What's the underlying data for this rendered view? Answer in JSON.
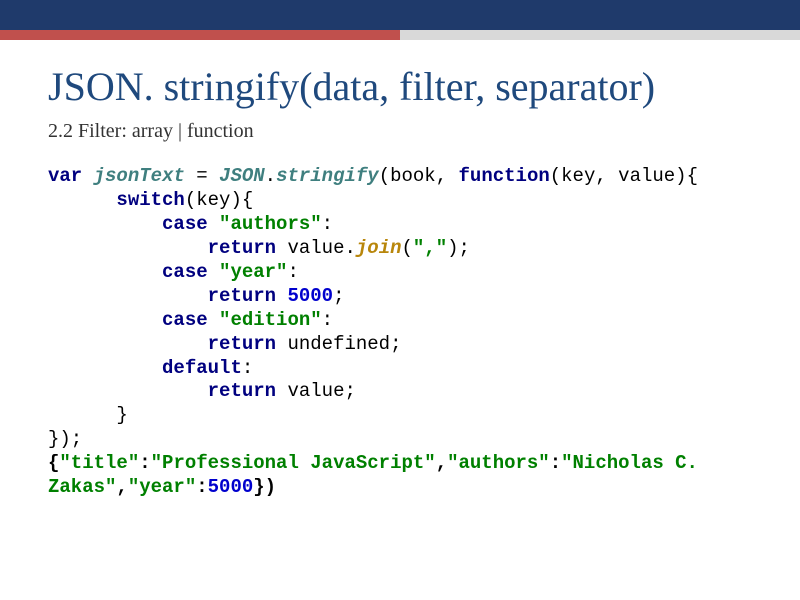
{
  "header": {
    "title": "JSON. stringify(data, filter, separator)",
    "subtitle": "2.2 Filter: array | function"
  },
  "code": {
    "t_var": "var",
    "t_jsonText": "jsonText",
    "t_eq": " = ",
    "t_JSON": "JSON",
    "t_dot": ".",
    "t_stringify": "stringify",
    "t_open1": "(book, ",
    "t_function": "function",
    "t_args": "(key, value){",
    "t_switch": "switch",
    "t_switchArg": "(key){",
    "t_case": "case",
    "t_authors": "\"authors\"",
    "t_colon": ":",
    "t_return": "return",
    "t_valDot": " value.",
    "t_join": "join",
    "t_joinOpen": "(",
    "t_comma": "\",\"",
    "t_joinClose": ");",
    "t_year": "\"year\"",
    "t_5000": "5000",
    "t_semi": ";",
    "t_edition": "\"edition\"",
    "t_undef": " undefined;",
    "t_default": "default",
    "t_retVal": " value;",
    "t_braceClose1": "      }",
    "t_braceClose2": "});",
    "t_resOpen": "{",
    "t_title": "\"title\"",
    "t_profJS": "\"Professional JavaScript\"",
    "t_authorsK": "\"authors\"",
    "t_zakas1": "\"Nicholas C. ",
    "t_zakas2": "Zakas\"",
    "t_yearK": "\"year\"",
    "t_resClose": "})",
    "t_sp": " ",
    "t_cm": ","
  }
}
